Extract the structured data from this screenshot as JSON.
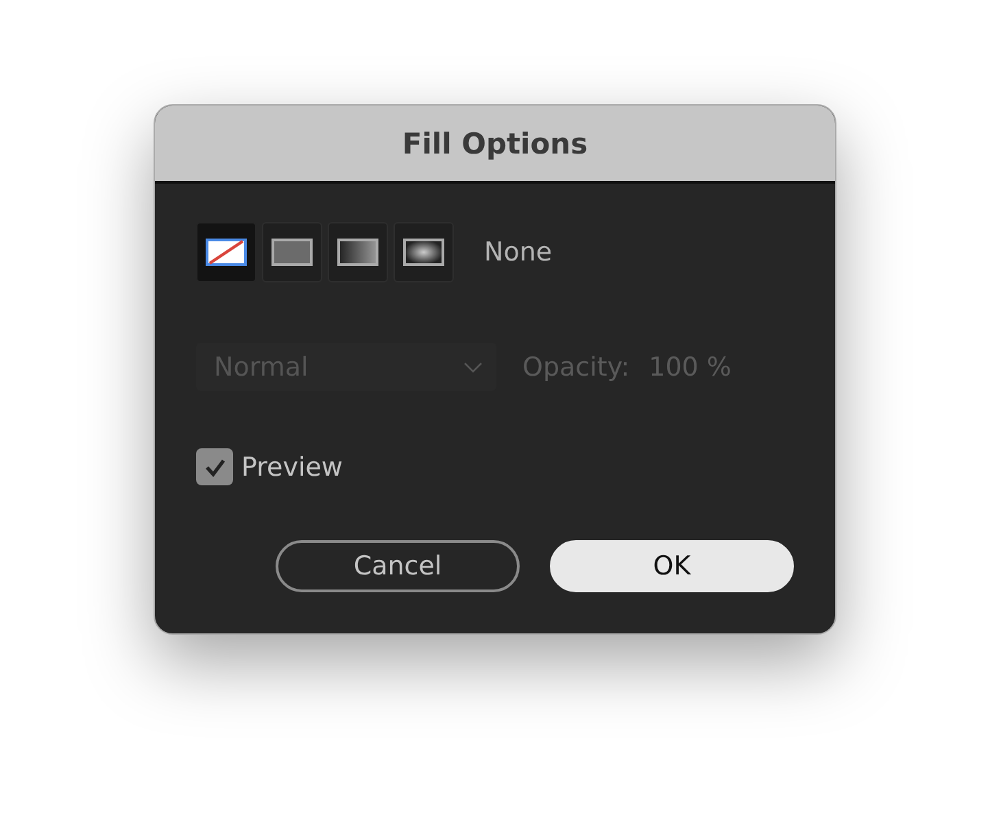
{
  "dialog": {
    "title": "Fill Options"
  },
  "fill_types": [
    {
      "kind": "none",
      "selected": true
    },
    {
      "kind": "solid",
      "selected": false
    },
    {
      "kind": "linear",
      "selected": false
    },
    {
      "kind": "radial",
      "selected": false
    }
  ],
  "fill_label": "None",
  "blend_mode": {
    "value": "Normal",
    "disabled": true
  },
  "opacity": {
    "label": "Opacity:",
    "value": "100 %",
    "disabled": true
  },
  "preview": {
    "label": "Preview",
    "checked": true
  },
  "buttons": [
    {
      "label": "Cancel",
      "kind": "secondary"
    },
    {
      "label": "OK",
      "kind": "primary"
    }
  ]
}
